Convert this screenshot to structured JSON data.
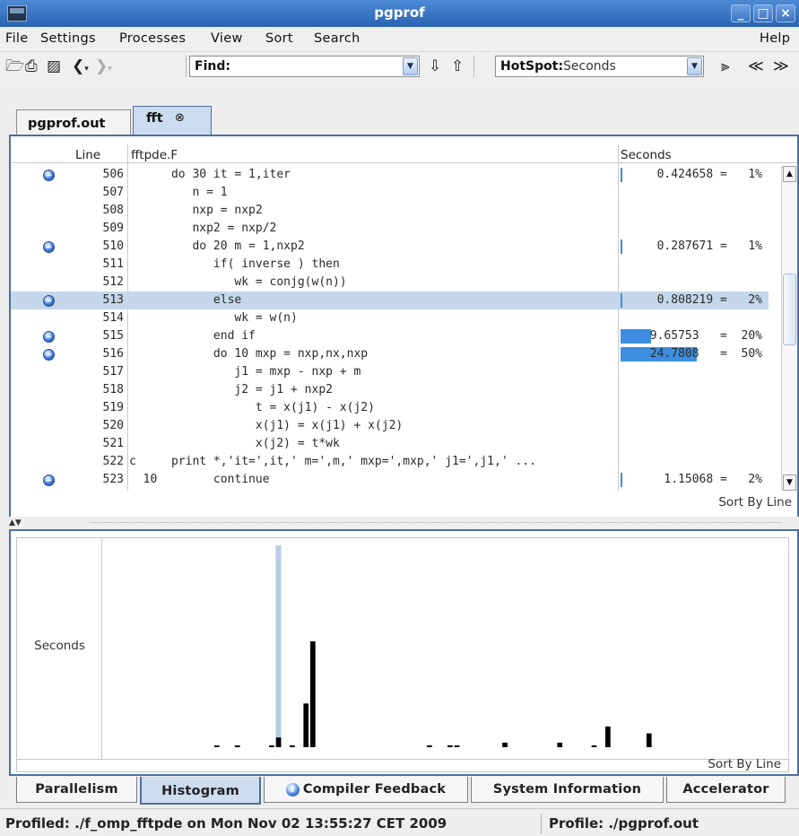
{
  "window": {
    "title": "pgprof",
    "minimize": "_",
    "maximize": "□",
    "close": "×"
  },
  "menubar": {
    "items": [
      "File",
      "Settings",
      "Processes",
      "View",
      "Sort",
      "Search"
    ],
    "help": "Help"
  },
  "toolbar": {
    "find_label": "Find:",
    "find_value": "",
    "hotspot_label": "HotSpot:",
    "hotspot_value": "Seconds"
  },
  "file_tabs": [
    {
      "label": "pgprof.out",
      "active": false
    },
    {
      "label": "fft",
      "close_glyph": "⊗",
      "active": true
    }
  ],
  "source": {
    "columns": {
      "line": "Line",
      "file": "fftpde.F",
      "metric": "Seconds"
    },
    "rows": [
      {
        "line": "506",
        "code": "      do 30 it = 1,iter",
        "seconds": "0.424658 =   1%",
        "marker": true,
        "selected": false,
        "bar": 0
      },
      {
        "line": "507",
        "code": "         n = 1",
        "seconds": "",
        "marker": false,
        "selected": false,
        "bar": 0
      },
      {
        "line": "508",
        "code": "         nxp = nxp2",
        "seconds": "",
        "marker": false,
        "selected": false,
        "bar": 0
      },
      {
        "line": "509",
        "code": "         nxp2 = nxp/2",
        "seconds": "",
        "marker": false,
        "selected": false,
        "bar": 0
      },
      {
        "line": "510",
        "code": "         do 20 m = 1,nxp2",
        "seconds": "0.287671 =   1%",
        "marker": true,
        "selected": false,
        "bar": 0
      },
      {
        "line": "511",
        "code": "            if( inverse ) then",
        "seconds": "",
        "marker": false,
        "selected": false,
        "bar": 0
      },
      {
        "line": "512",
        "code": "               wk = conjg(w(n))",
        "seconds": "",
        "marker": false,
        "selected": false,
        "bar": 0
      },
      {
        "line": "513",
        "code": "            else",
        "seconds": "0.808219 =   2%",
        "marker": true,
        "selected": true,
        "bar": 0
      },
      {
        "line": "514",
        "code": "               wk = w(n)",
        "seconds": "",
        "marker": false,
        "selected": false,
        "bar": 0
      },
      {
        "line": "515",
        "code": "            end if",
        "seconds": "9.65753   =  20%",
        "marker": true,
        "selected": false,
        "bar": 0.4
      },
      {
        "line": "516",
        "code": "            do 10 mxp = nxp,nx,nxp",
        "seconds": "24.7808   =  50%",
        "marker": true,
        "selected": false,
        "bar": 1
      },
      {
        "line": "517",
        "code": "               j1 = mxp - nxp + m",
        "seconds": "",
        "marker": false,
        "selected": false,
        "bar": 0
      },
      {
        "line": "518",
        "code": "               j2 = j1 + nxp2",
        "seconds": "",
        "marker": false,
        "selected": false,
        "bar": 0
      },
      {
        "line": "519",
        "code": "                  t = x(j1) - x(j2)",
        "seconds": "",
        "marker": false,
        "selected": false,
        "bar": 0
      },
      {
        "line": "520",
        "code": "                  x(j1) = x(j1) + x(j2)",
        "seconds": "",
        "marker": false,
        "selected": false,
        "bar": 0
      },
      {
        "line": "521",
        "code": "                  x(j2) = t*wk",
        "seconds": "",
        "marker": false,
        "selected": false,
        "bar": 0
      },
      {
        "line": "522",
        "code": "c     print *,'it=',it,' m=',m,' mxp=',mxp,' j1=',j1,' ...",
        "seconds": "",
        "marker": false,
        "selected": false,
        "bar": 0
      },
      {
        "line": "523",
        "code": "  10        continue",
        "seconds": "1.15068 =   2%",
        "marker": true,
        "selected": false,
        "bar": 0
      }
    ],
    "sort_label": "Sort By Line"
  },
  "histogram": {
    "ylabel": "Seconds",
    "sort_label": "Sort By Line",
    "colors": {
      "bar": "#000000",
      "highlight": "#b6cde4"
    }
  },
  "chart_data": {
    "type": "bar",
    "xlabel": "",
    "ylabel": "Seconds",
    "highlight_index": 25,
    "values": [
      0,
      0,
      0,
      0,
      0,
      0,
      0,
      0,
      0,
      0,
      0,
      0,
      0,
      0,
      0,
      0,
      0.05,
      0,
      0,
      0.05,
      0,
      0,
      0,
      0,
      0.05,
      0.42,
      0,
      0.05,
      0,
      1.9,
      4.6,
      0,
      0,
      0,
      0,
      0,
      0,
      0,
      0,
      0,
      0,
      0,
      0,
      0,
      0,
      0,
      0,
      0.05,
      0,
      0,
      0.05,
      0.05,
      0,
      0,
      0,
      0,
      0,
      0,
      0.2,
      0,
      0,
      0,
      0,
      0,
      0,
      0,
      0.2,
      0,
      0,
      0,
      0,
      0.05,
      0,
      0.9,
      0,
      0,
      0,
      0,
      0,
      0.6,
      0,
      0,
      0,
      0,
      0,
      0,
      0,
      0,
      0,
      0,
      0,
      0,
      0,
      0,
      0,
      0,
      0,
      0,
      0,
      0
    ]
  },
  "bottom_tabs": [
    {
      "label": "Parallelism",
      "active": false,
      "icon": false
    },
    {
      "label": "Histogram",
      "active": true,
      "icon": false
    },
    {
      "label": "Compiler Feedback",
      "active": false,
      "icon": true
    },
    {
      "label": "System Information",
      "active": false,
      "icon": false
    },
    {
      "label": "Accelerator",
      "active": false,
      "icon": false
    }
  ],
  "status": {
    "profiled": "Profiled: ./f_omp_fftpde on Mon Nov 02 13:55:27 CET 2009",
    "profile": "Profile: ./pgprof.out"
  }
}
